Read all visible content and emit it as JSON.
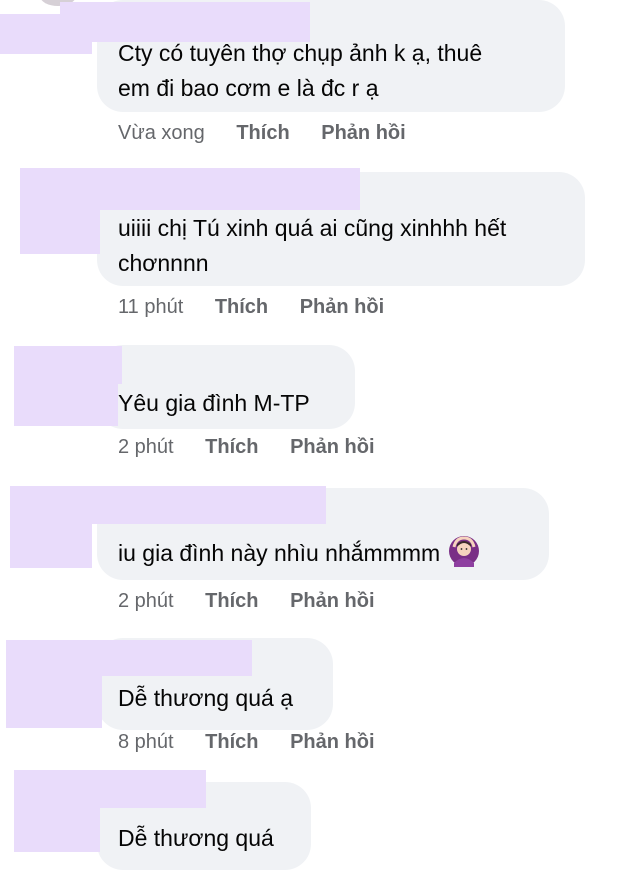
{
  "comments": [
    {
      "text_lines": [
        "Cty có tuyên thợ chụp ảnh k ạ, thuê",
        "em đi bao cơm e là đc r ạ"
      ],
      "time": "Vừa xong",
      "like": "Thích",
      "reply": "Phản hồi"
    },
    {
      "text_lines": [
        "uiiii chị Tú xinh quá ai cũng xinhhh hết",
        "chơnnnn"
      ],
      "time": "11 phút",
      "like": "Thích",
      "reply": "Phản hồi"
    },
    {
      "text_lines": [
        "Yêu gia đình M-TP"
      ],
      "time": "2 phút",
      "like": "Thích",
      "reply": "Phản hồi"
    },
    {
      "text_lines": [
        "iu gia đình này nhìu nhắmmmm"
      ],
      "emoji": "woman-gesturing-ok-emoji",
      "time": "2 phút",
      "like": "Thích",
      "reply": "Phản hồi"
    },
    {
      "text_lines": [
        "Dễ thương quá ạ"
      ],
      "time": "8 phút",
      "like": "Thích",
      "reply": "Phản hồi"
    },
    {
      "text_lines": [
        "Dễ thương quá"
      ]
    }
  ],
  "colors": {
    "bubble": "#f0f2f5",
    "redaction": "#e9dcfb",
    "meta": "#65676b",
    "text": "#050505"
  }
}
